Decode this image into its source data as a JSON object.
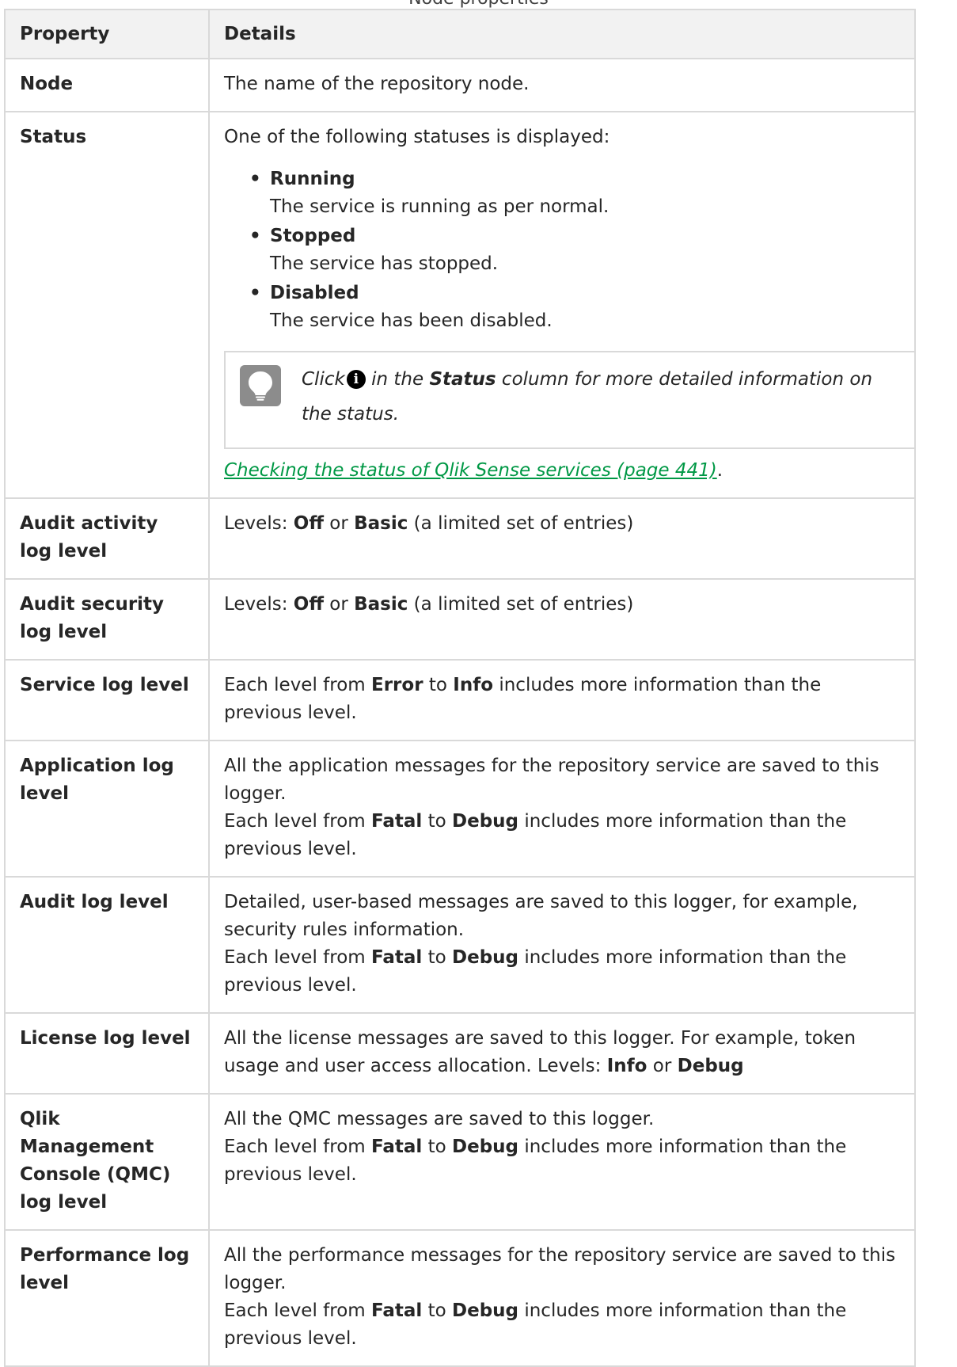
{
  "caption": "Node properties",
  "headers": {
    "property": "Property",
    "details": "Details"
  },
  "node": {
    "label": "Node",
    "text": "The name of the repository node."
  },
  "status": {
    "label": "Status",
    "intro": "One of the following statuses is displayed:",
    "items": [
      {
        "term": "Running",
        "desc": "The service is running as per normal."
      },
      {
        "term": "Stopped",
        "desc": "The service has stopped."
      },
      {
        "term": "Disabled",
        "desc": "The service has been disabled."
      }
    ],
    "tip": {
      "icon": "lightbulb-icon",
      "click": "Click",
      "info_icon": "info-icon",
      "in_the": " in the ",
      "status_word": "Status",
      "rest": " column for more detailed information on the status."
    },
    "link": "Checking the status of Qlik Sense services (page 441)",
    "link_period": "."
  },
  "audit_activity": {
    "label": "Audit activity log level",
    "p1": "Levels: ",
    "off": "Off",
    "or": " or ",
    "basic": "Basic",
    "rest": " (a limited set of entries)"
  },
  "audit_security": {
    "label": "Audit security log level",
    "p1": "Levels: ",
    "off": "Off",
    "or": " or ",
    "basic": "Basic",
    "rest": " (a limited set of entries)"
  },
  "service_log": {
    "label": "Service log level",
    "p1": "Each level from ",
    "from": "Error",
    "to": " to ",
    "until": "Info",
    "rest": " includes more information than the previous level."
  },
  "application_log": {
    "label": "Application log level",
    "line1": "All the application messages for the repository service are saved to this logger.",
    "p1": "Each level from ",
    "from": "Fatal",
    "to": " to ",
    "until": "Debug",
    "rest": " includes more information than the previous level."
  },
  "audit_log": {
    "label": "Audit log level",
    "line1": "Detailed, user-based messages are saved to this logger, for example, security rules information.",
    "p1": "Each level from ",
    "from": "Fatal",
    "to": " to ",
    "until": "Debug",
    "rest": " includes more information than the previous level."
  },
  "license_log": {
    "label": "License log level",
    "line1": "All the license messages are saved to this logger. For example, token usage and user access allocation. Levels: ",
    "info": "Info",
    "or": " or ",
    "debug": "Debug"
  },
  "qmc_log": {
    "label": "Qlik Management Console (QMC) log level",
    "line1": "All the QMC messages are saved to this logger.",
    "p1": "Each level from ",
    "from": "Fatal",
    "to": " to ",
    "until": "Debug",
    "rest": " includes more information than the previous level."
  },
  "performance_log": {
    "label": "Performance log level",
    "line1": "All the performance messages for the repository service are saved to this logger.",
    "p1": "Each level from ",
    "from": "Fatal",
    "to": " to ",
    "until": "Debug",
    "rest": " includes more information than the previous level."
  },
  "colors": {
    "link": "#009845",
    "border": "#d9d9d9",
    "header_bg": "#f2f2f2",
    "bulb": "#8c8c8c"
  }
}
